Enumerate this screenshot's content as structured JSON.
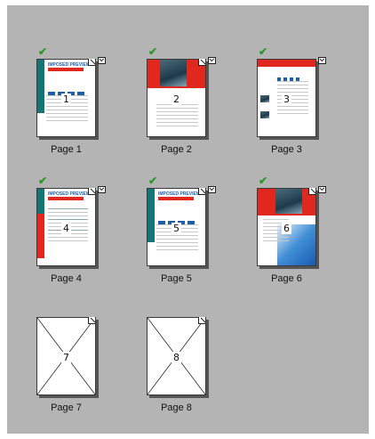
{
  "pages": [
    {
      "label": "Page 1",
      "number": "1",
      "checked": true,
      "icons": [
        "corner-icon",
        "mail-icon"
      ]
    },
    {
      "label": "Page 2",
      "number": "2",
      "checked": true,
      "icons": [
        "corner-icon",
        "mail-icon"
      ]
    },
    {
      "label": "Page 3",
      "number": "3",
      "checked": true,
      "icons": [
        "mail-icon"
      ]
    },
    {
      "label": "Page 4",
      "number": "4",
      "checked": true,
      "icons": [
        "corner-icon",
        "mail-icon"
      ]
    },
    {
      "label": "Page 5",
      "number": "5",
      "checked": true,
      "icons": [
        "corner-icon",
        "mail-icon"
      ]
    },
    {
      "label": "Page 6",
      "number": "6",
      "checked": true,
      "icons": [
        "corner-icon",
        "mail-icon"
      ]
    },
    {
      "label": "Page 7",
      "number": "7",
      "checked": false,
      "icons": [
        "corner-icon"
      ]
    },
    {
      "label": "Page 8",
      "number": "8",
      "checked": false,
      "icons": [
        "corner-icon"
      ]
    }
  ],
  "header_text": {
    "logo": "IMPOSED PREVIEW"
  },
  "colors": {
    "background": "#b4b4b4",
    "check": "#2a9a2a",
    "brand_red": "#e0281e",
    "brand_teal": "#147575",
    "brand_blue": "#1c5fa8"
  }
}
